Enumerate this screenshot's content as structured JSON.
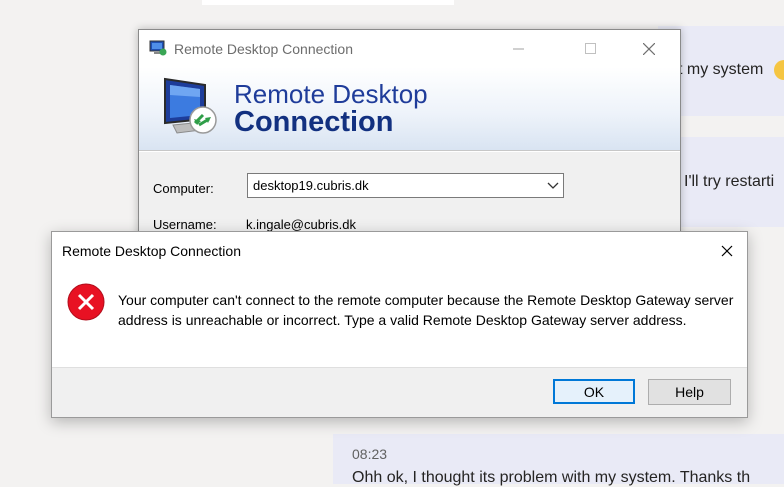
{
  "chat": {
    "msg1_fragment": "t my system",
    "msg2_fragment": "I'll try restarti",
    "msg3_time": "08:23",
    "msg3_text": "Ohh ok, I thought its problem with my system. Thanks th"
  },
  "rdc_window": {
    "title": "Remote Desktop Connection",
    "brand_line1": "Remote Desktop",
    "brand_line2": "Connection",
    "computer_label": "Computer:",
    "computer_value": "desktop19.cubris.dk",
    "username_label": "Username:",
    "username_value": "k.ingale@cubris.dk"
  },
  "error_dialog": {
    "title": "Remote Desktop Connection",
    "message": "Your computer can't connect to the remote computer because the Remote Desktop Gateway server address is unreachable or incorrect. Type a valid Remote Desktop Gateway server address.",
    "ok_label": "OK",
    "help_label": "Help"
  },
  "icons": {
    "window_icon": "remote-desktop-icon",
    "error_icon": "error-x-circle-icon",
    "close_icon": "close-icon"
  },
  "colors": {
    "brand_blue": "#1f3c9a",
    "error_red": "#e81123",
    "focus_blue": "#0078d7",
    "chat_bubble": "#e9eaf6"
  }
}
